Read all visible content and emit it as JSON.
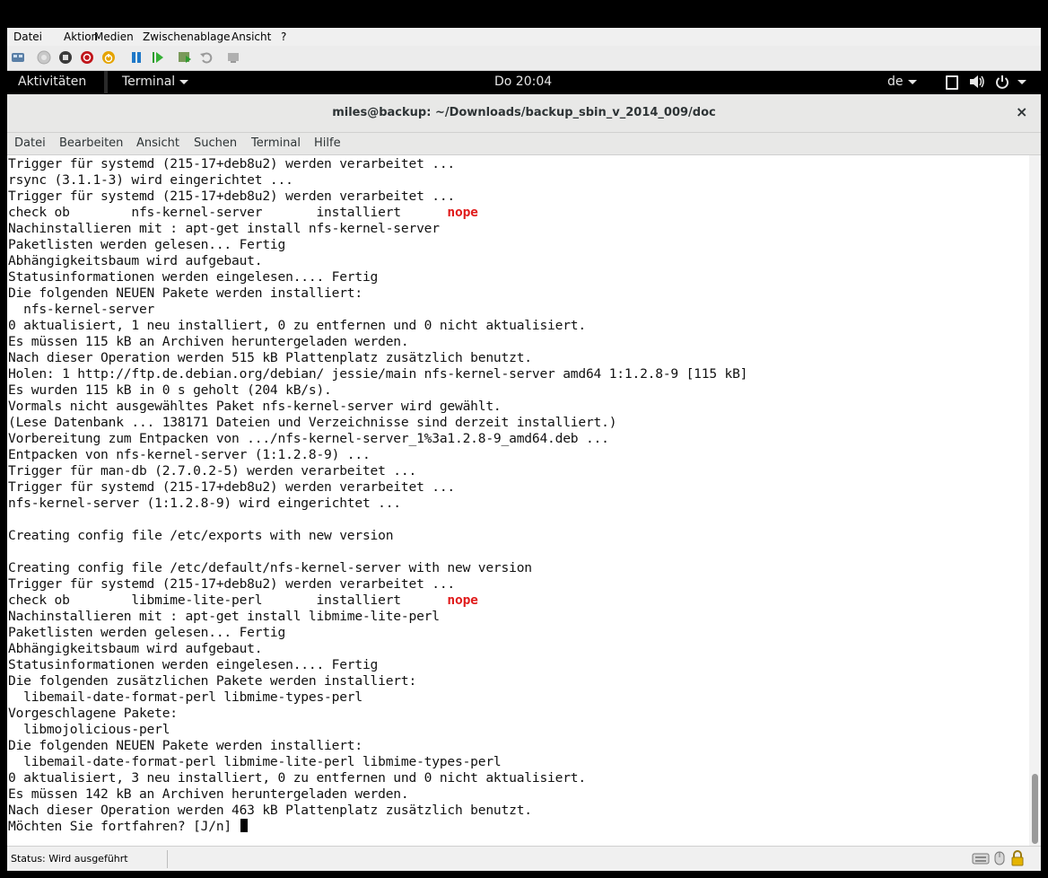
{
  "host_menu": [
    "Datei",
    "Aktion",
    "Medien",
    "Zwischenablage",
    "Ansicht",
    "?"
  ],
  "host_toolbar_icons": [
    "ctrl-alt-del-icon",
    "start-icon",
    "turn-off-icon",
    "shutdown-icon",
    "save-icon",
    "pause-icon",
    "resume-icon",
    "checkpoint-icon",
    "revert-icon",
    "enhanced-session-icon"
  ],
  "topbar": {
    "activities": "Aktivitäten",
    "app": "Terminal",
    "clock": "Do 20:04",
    "lang": "de"
  },
  "terminal": {
    "title": "miles@backup: ~/Downloads/backup_sbin_v_2014_009/doc",
    "menu": [
      "Datei",
      "Bearbeiten",
      "Ansicht",
      "Suchen",
      "Terminal",
      "Hilfe"
    ],
    "lines": [
      "Trigger für systemd (215-17+deb8u2) werden verarbeitet ...",
      "rsync (3.1.1-3) wird eingerichtet ...",
      "Trigger für systemd (215-17+deb8u2) werden verarbeitet ...",
      "check ob        nfs-kernel-server       installiert      ",
      "Nachinstallieren mit : apt-get install nfs-kernel-server",
      "Paketlisten werden gelesen... Fertig",
      "Abhängigkeitsbaum wird aufgebaut.",
      "Statusinformationen werden eingelesen.... Fertig",
      "Die folgenden NEUEN Pakete werden installiert:",
      "  nfs-kernel-server",
      "0 aktualisiert, 1 neu installiert, 0 zu entfernen und 0 nicht aktualisiert.",
      "Es müssen 115 kB an Archiven heruntergeladen werden.",
      "Nach dieser Operation werden 515 kB Plattenplatz zusätzlich benutzt.",
      "Holen: 1 http://ftp.de.debian.org/debian/ jessie/main nfs-kernel-server amd64 1:1.2.8-9 [115 kB]",
      "Es wurden 115 kB in 0 s geholt (204 kB/s).",
      "Vormals nicht ausgewähltes Paket nfs-kernel-server wird gewählt.",
      "(Lese Datenbank ... 138171 Dateien und Verzeichnisse sind derzeit installiert.)",
      "Vorbereitung zum Entpacken von .../nfs-kernel-server_1%3a1.2.8-9_amd64.deb ...",
      "Entpacken von nfs-kernel-server (1:1.2.8-9) ...",
      "Trigger für man-db (2.7.0.2-5) werden verarbeitet ...",
      "Trigger für systemd (215-17+deb8u2) werden verarbeitet ...",
      "nfs-kernel-server (1:1.2.8-9) wird eingerichtet ...",
      "",
      "Creating config file /etc/exports with new version",
      "",
      "Creating config file /etc/default/nfs-kernel-server with new version",
      "Trigger für systemd (215-17+deb8u2) werden verarbeitet ...",
      "check ob        libmime-lite-perl       installiert      ",
      "Nachinstallieren mit : apt-get install libmime-lite-perl",
      "Paketlisten werden gelesen... Fertig",
      "Abhängigkeitsbaum wird aufgebaut.",
      "Statusinformationen werden eingelesen.... Fertig",
      "Die folgenden zusätzlichen Pakete werden installiert:",
      "  libemail-date-format-perl libmime-types-perl",
      "Vorgeschlagene Pakete:",
      "  libmojolicious-perl",
      "Die folgenden NEUEN Pakete werden installiert:",
      "  libemail-date-format-perl libmime-lite-perl libmime-types-perl",
      "0 aktualisiert, 3 neu installiert, 0 zu entfernen und 0 nicht aktualisiert.",
      "Es müssen 142 kB an Archiven heruntergeladen werden.",
      "Nach dieser Operation werden 463 kB Plattenplatz zusätzlich benutzt.",
      "Möchten Sie fortfahren? [J/n] "
    ],
    "nope_word": "nope",
    "nope_color": "#e01b1b"
  },
  "status": "Status: Wird ausgeführt"
}
